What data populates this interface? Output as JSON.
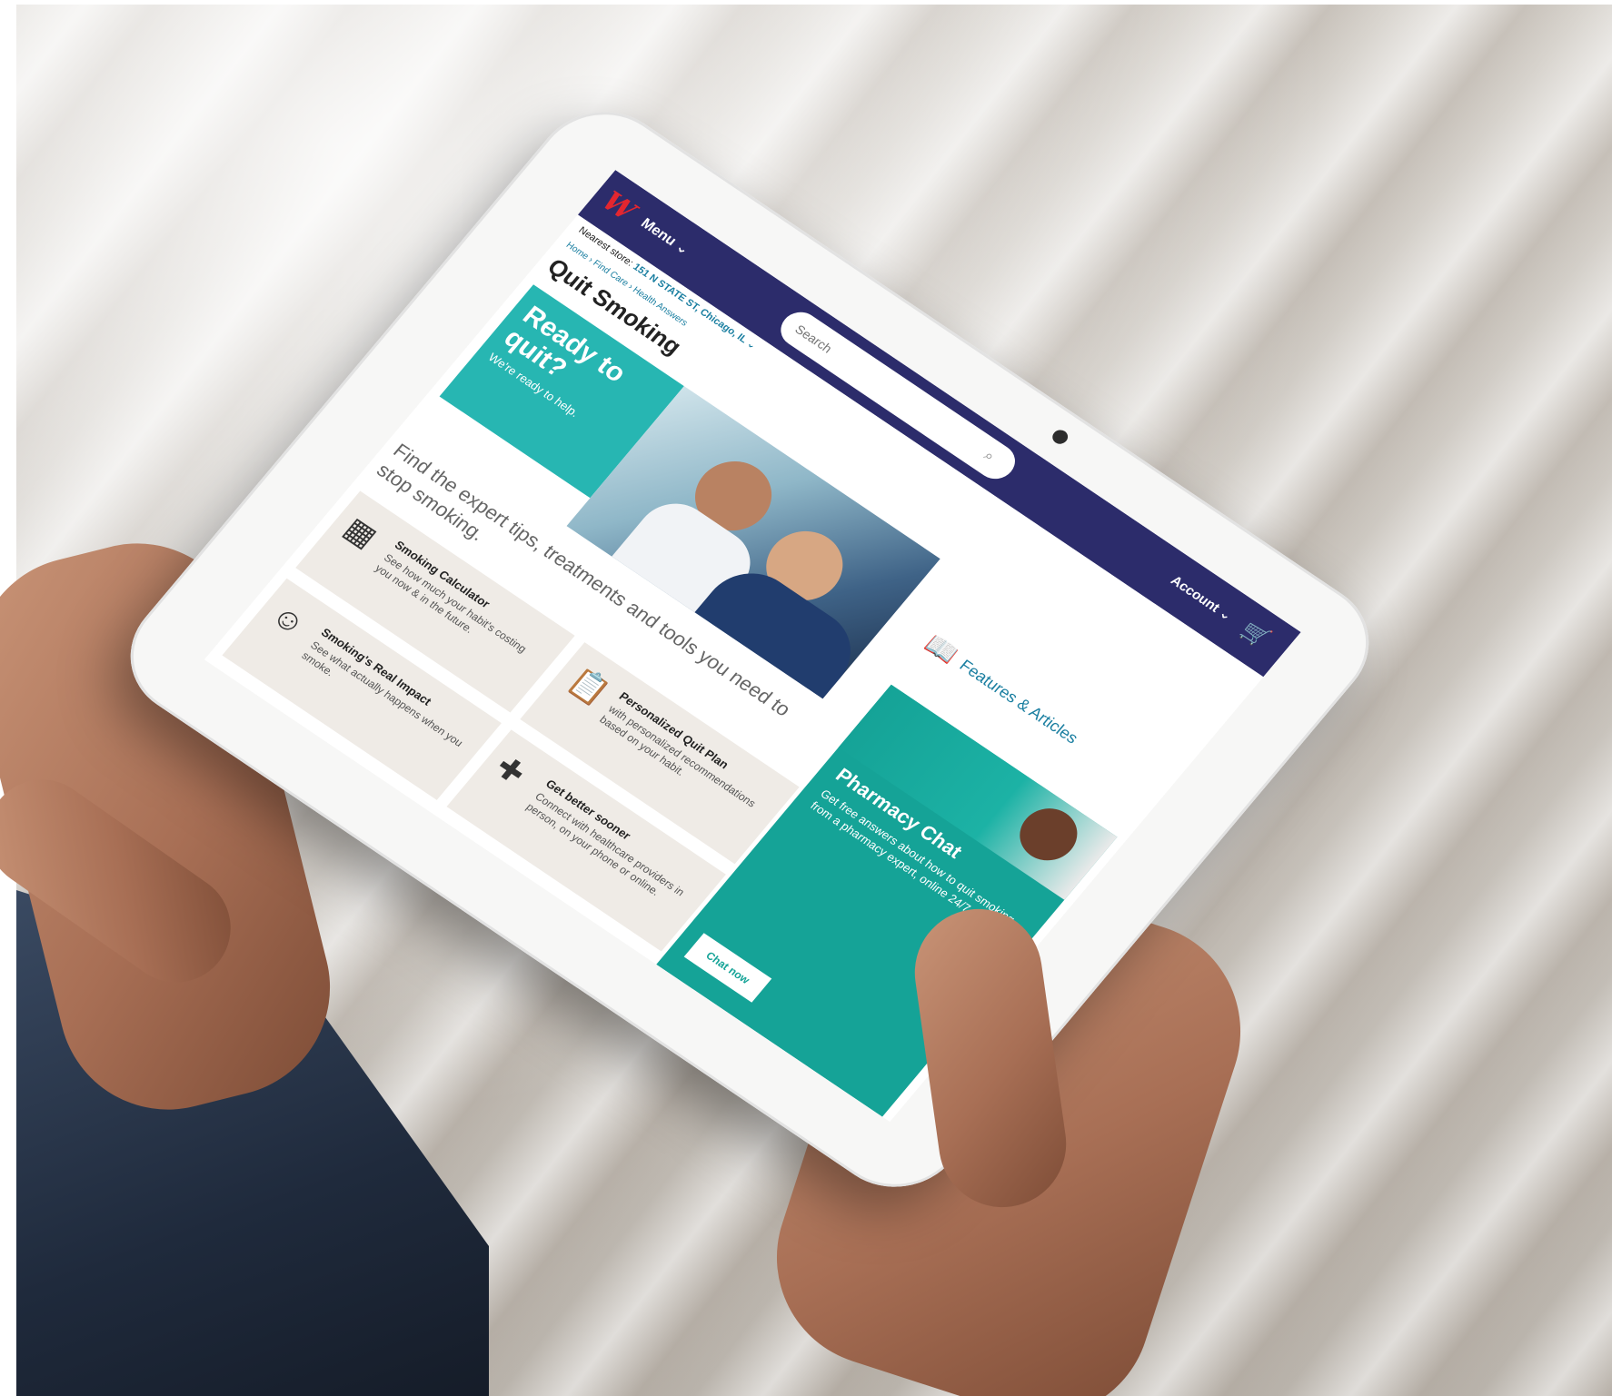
{
  "header": {
    "logo_text": "W",
    "menu_label": "Menu ⌄",
    "search_placeholder": "Search",
    "account_label": "Account ⌄"
  },
  "store": {
    "prefix": "Nearest store:",
    "address": "151 N STATE ST, Chicago, IL ⌄"
  },
  "breadcrumb": [
    "Home",
    "Find Care",
    "Health Answers"
  ],
  "breadcrumb_text": "Home  ›  Find Care  ›  Health Answers",
  "page_title": "Quit Smoking",
  "hero": {
    "heading": "Ready to quit?",
    "subheading": "We're ready to help."
  },
  "features_label": "Features & Articles",
  "intro": "Find the expert tips, treatments and tools you need to stop smoking.",
  "cards": [
    {
      "title": "Smoking Calculator",
      "desc": "See how much your habit's costing you now & in the future.",
      "icon": "calculator-icon"
    },
    {
      "title": "Personalized Quit Plan",
      "desc": "with personalized recommendations based on your habit.",
      "icon": "clipboard-check-icon"
    },
    {
      "title": "Smoking's Real Impact",
      "desc": "See what actually happens when you smoke.",
      "icon": "person-icon"
    },
    {
      "title": "Get better sooner",
      "desc": "Connect with healthcare providers in person, on your phone or online.",
      "icon": "medical-bag-icon"
    }
  ],
  "pharmacy_chat": {
    "title": "Pharmacy Chat",
    "desc": "Get free answers about how to quit smoking from a pharmacy expert, online 24/7.",
    "button": "Chat now"
  },
  "colors": {
    "header_bg": "#2c2c6b",
    "brand_red": "#e3262f",
    "teal": "#27b6b2",
    "chat_teal": "#15a397",
    "link_blue": "#1b7fa1",
    "card_bg": "#efebe6"
  }
}
